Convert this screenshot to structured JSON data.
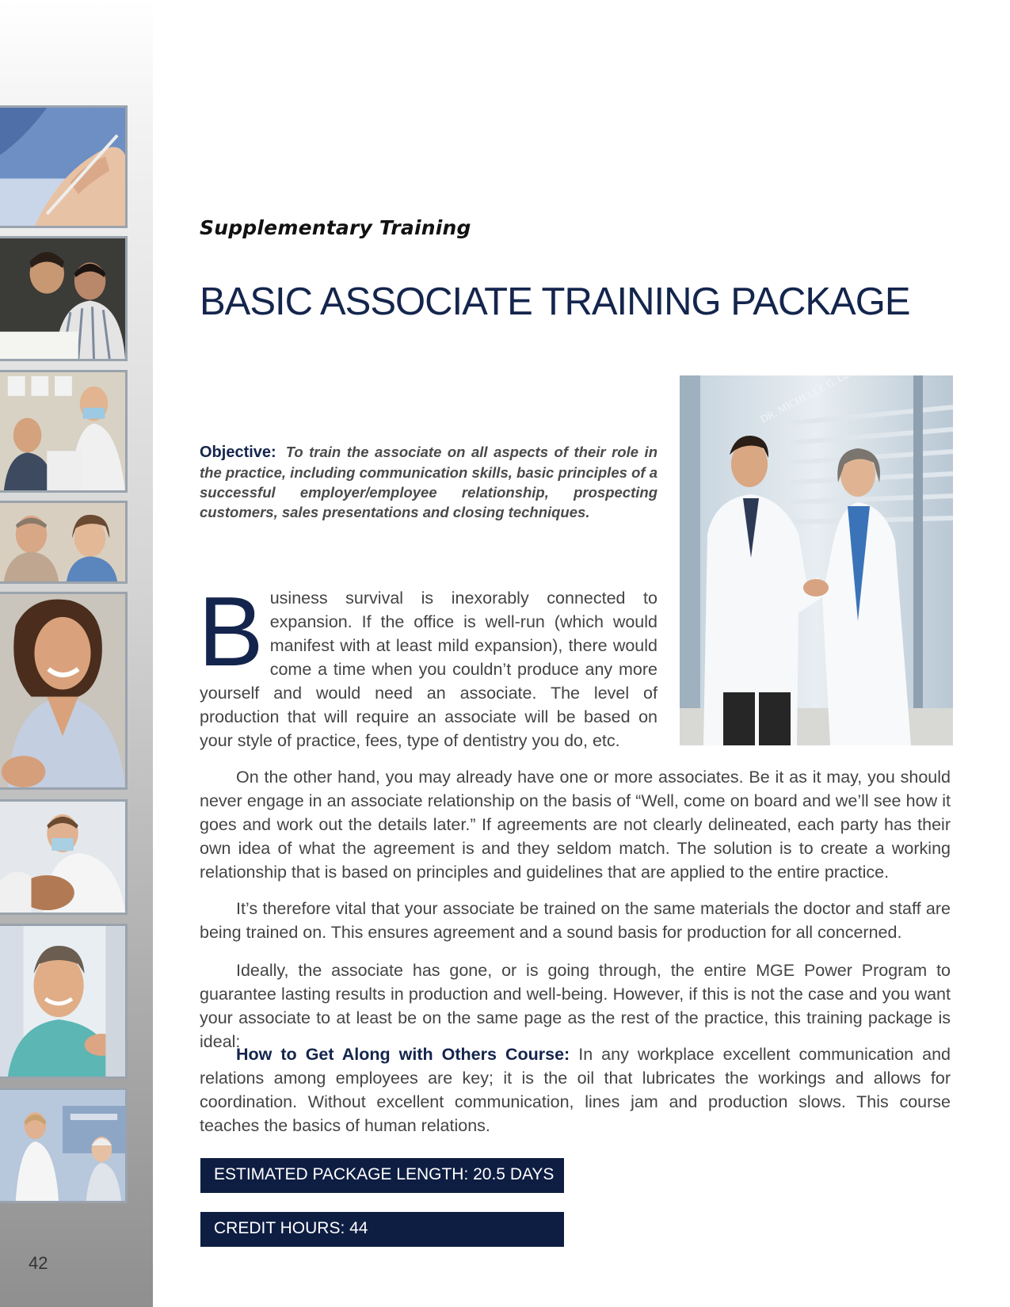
{
  "section_label": "Supplementary Training",
  "title": "BASIC ASSOCIATE TRAINING PACKAGE",
  "objective": {
    "label": "Objective:",
    "text": "To train the associate on all aspects of their role in the practice, including communication skills, basic principles of a successful employer/employee relationship, prospecting customers, sales presentations and closing techniques."
  },
  "intro": {
    "dropcap": "B",
    "text": "usiness survival is inexorably connected to expansion. If the office is well-run (which would manifest with at least mild expansion), there would come a time when you couldn’t produce any more yourself and would need an associate. The level of production that will require an associate will be based on your style of practice, fees, type of dentistry you do, etc."
  },
  "paragraphs": [
    "On the other hand, you may already have one or more associates. Be it as it may, you should never engage in an associate relationship on the basis of “Well, come on board and we’ll see how it goes and work out the details later.” If agreements are not clearly delineated, each party has their own idea of what the agreement is and they seldom match. The solution is to create a working relationship that is based on principles and guidelines that are applied to the entire practice.",
    "It’s therefore vital that your associate be trained on the same materials the doctor and staff are being trained on. This ensures agreement and a sound basis for production for all concerned.",
    "Ideally, the associate has gone, or is going through, the entire MGE Power Program to guarantee lasting results in production and well-being. However, if this is not the case and you want your associate to at least be on the same page as the rest of the practice, this training package is ideal:"
  ],
  "course": {
    "title": "How to Get Along with Others Course:",
    "text": "In any workplace excellent communication and relations among employees are key; it is the oil that lubricates the workings and allows for coordination. Without excellent communication, lines jam and production slows. This course teaches the basics of human relations."
  },
  "info_bars": {
    "length": "ESTIMATED PACKAGE LENGTH: 20.5 DAYS",
    "credits": "CREDIT HOURS: 44"
  },
  "page_number": "42",
  "hero_sign": "DR. MICHELLE G. GENERAL DENTIST"
}
